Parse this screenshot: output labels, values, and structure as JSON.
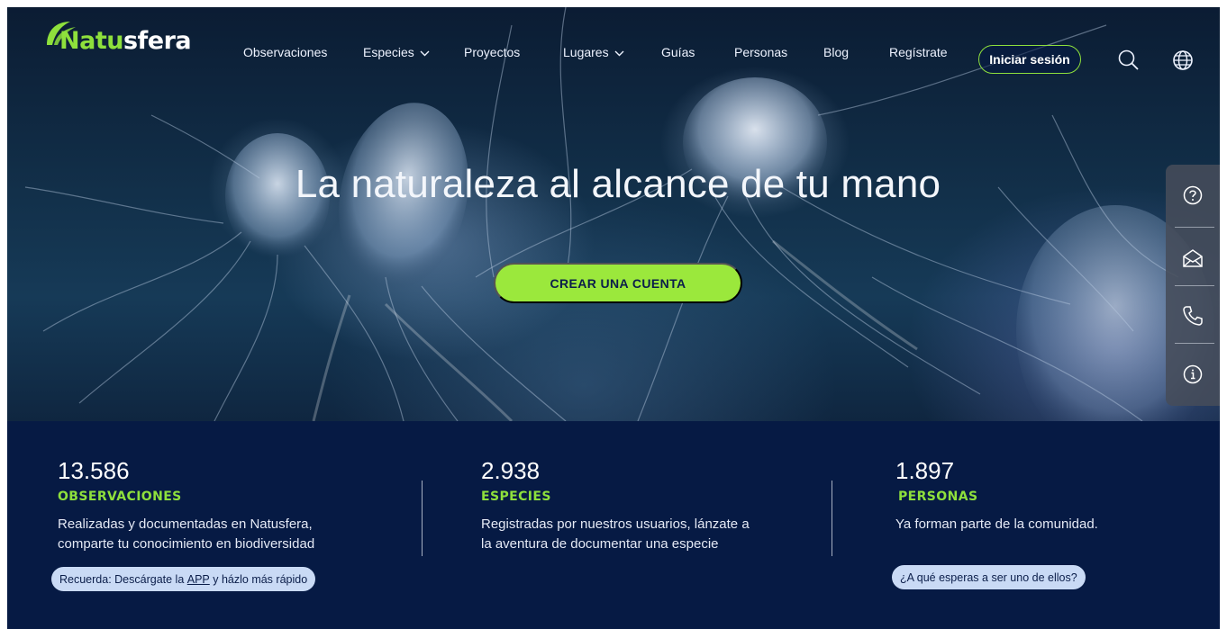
{
  "brand": {
    "part1": "Natu",
    "part2": "sfera"
  },
  "nav": {
    "items": [
      {
        "label": "Observaciones",
        "dropdown": false
      },
      {
        "label": "Especies",
        "dropdown": true
      },
      {
        "label": "Proyectos",
        "dropdown": false
      },
      {
        "label": "Lugares",
        "dropdown": true
      },
      {
        "label": "Guías",
        "dropdown": false
      },
      {
        "label": "Personas",
        "dropdown": false
      },
      {
        "label": "Blog",
        "dropdown": false
      },
      {
        "label": "Regístrate",
        "dropdown": false
      }
    ],
    "login_label": "Iniciar sesión",
    "icons": [
      "search-icon",
      "globe-icon"
    ]
  },
  "hero": {
    "title": "La naturaleza al alcance de tu mano",
    "cta_label": "CREAR UNA CUENTA"
  },
  "side_panel": {
    "icons": [
      "help-icon",
      "mail-icon",
      "phone-icon",
      "info-icon"
    ]
  },
  "stats": [
    {
      "value": "13.586",
      "label": "OBSERVACIONES",
      "desc_line1": "Realizadas y documentadas en Natusfera,",
      "desc_line2": "comparte tu conocimiento en biodiversidad",
      "pill_pre": "Recuerda: Descárgate la ",
      "pill_link": "APP",
      "pill_post": " y házlo más rápido"
    },
    {
      "value": "2.938",
      "label": "ESPECIES",
      "desc_line1": "Registradas por nuestros usuarios, lánzate a",
      "desc_line2": "la aventura de documentar una especie"
    },
    {
      "value": "1.897",
      "label": "PERSONAS",
      "desc_line1": "Ya forman parte de la comunidad.",
      "pill": "¿A qué esperas a ser uno de ellos?"
    }
  ],
  "colors": {
    "accent_green": "#8ee03c",
    "cta_green": "#9be83c",
    "navy": "#061a44",
    "pill_bg": "#c9daf5"
  }
}
